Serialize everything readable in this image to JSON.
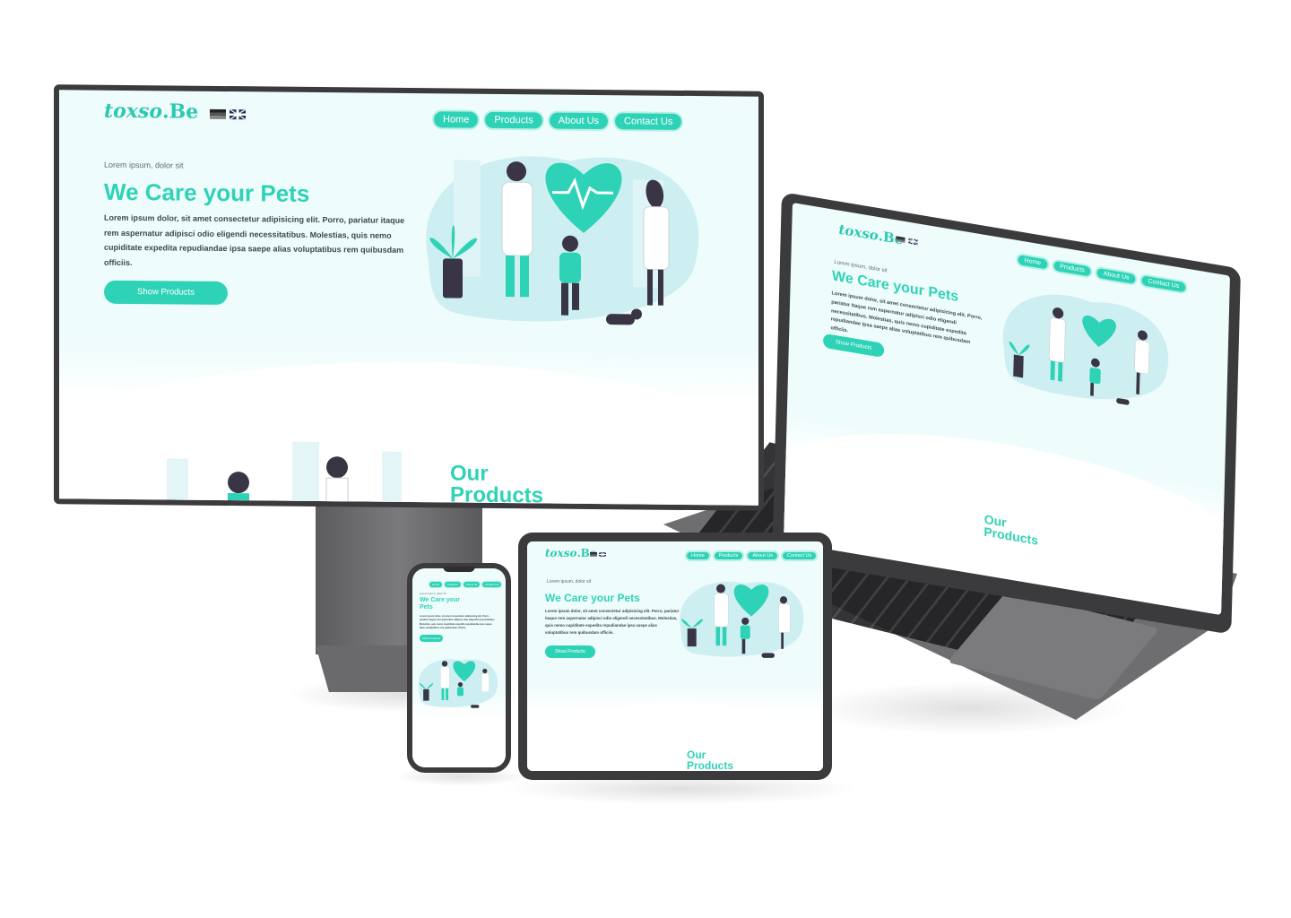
{
  "site": {
    "logo": "toxso",
    "logo_suffix": ".Be",
    "flags": [
      "flag-de-icon",
      "flag-uk-icon"
    ],
    "nav": [
      "Home",
      "Products",
      "About Us",
      "Contact Us"
    ],
    "kicker": "Lorem ipsum, dolor sit",
    "title": "We Care your Pets",
    "body": "Lorem ipsum dolor, sit amet consectetur adipisicing elit. Porro, pariatur itaque rem aspernatur adipisci odio eligendi necessitatibus. Molestias, quis nemo cupiditate expedita repudiandae ipsa saepe alias voluptatibus rem quibusdam officiis.",
    "cta": "Show Products",
    "section_title": "Our Products"
  },
  "colors": {
    "accent": "#2ed3b7",
    "background": "#effcfc",
    "device_bezel": "#3b3b3d",
    "illustration_dark": "#3a3545"
  },
  "illustration": {
    "icons": [
      "heart-pulse-icon",
      "doctor-icon",
      "nurse-icon",
      "child-icon",
      "dog-icon",
      "plant-icon"
    ]
  }
}
